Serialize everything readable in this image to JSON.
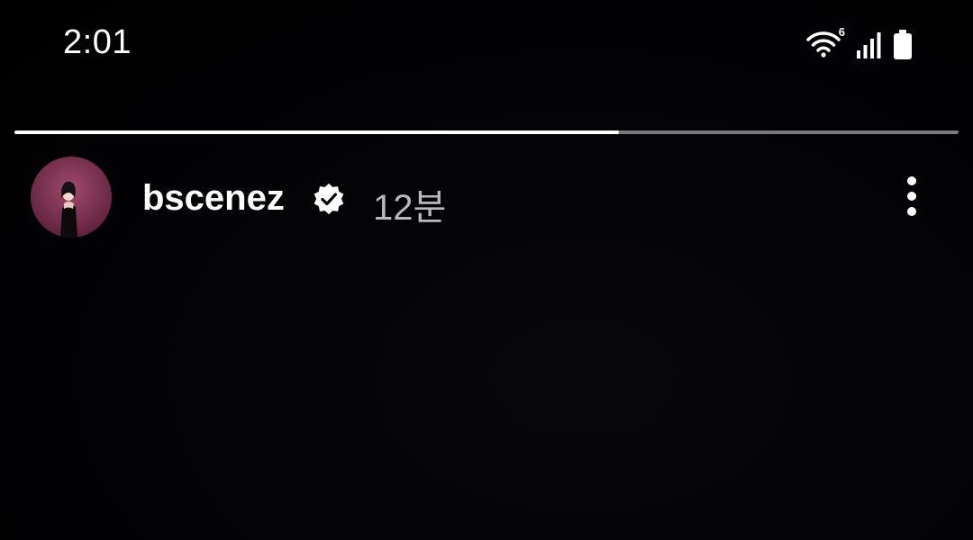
{
  "status_bar": {
    "time": "2:01",
    "wifi_badge": "6",
    "icons": [
      "wifi-icon",
      "cellular-signal-icon",
      "battery-icon"
    ]
  },
  "story": {
    "progress_fraction": 0.64,
    "username": "bscenez",
    "verified": true,
    "time_ago": "12분",
    "menu_icon": "more-vertical-icon"
  },
  "colors": {
    "background": "#000000",
    "progress_filled": "#ffffff",
    "progress_track": "#7a7a7a",
    "time_ago_text": "#b8b8b8",
    "verified_badge": "#ffffff",
    "avatar_bg": "#7a2a4a"
  }
}
